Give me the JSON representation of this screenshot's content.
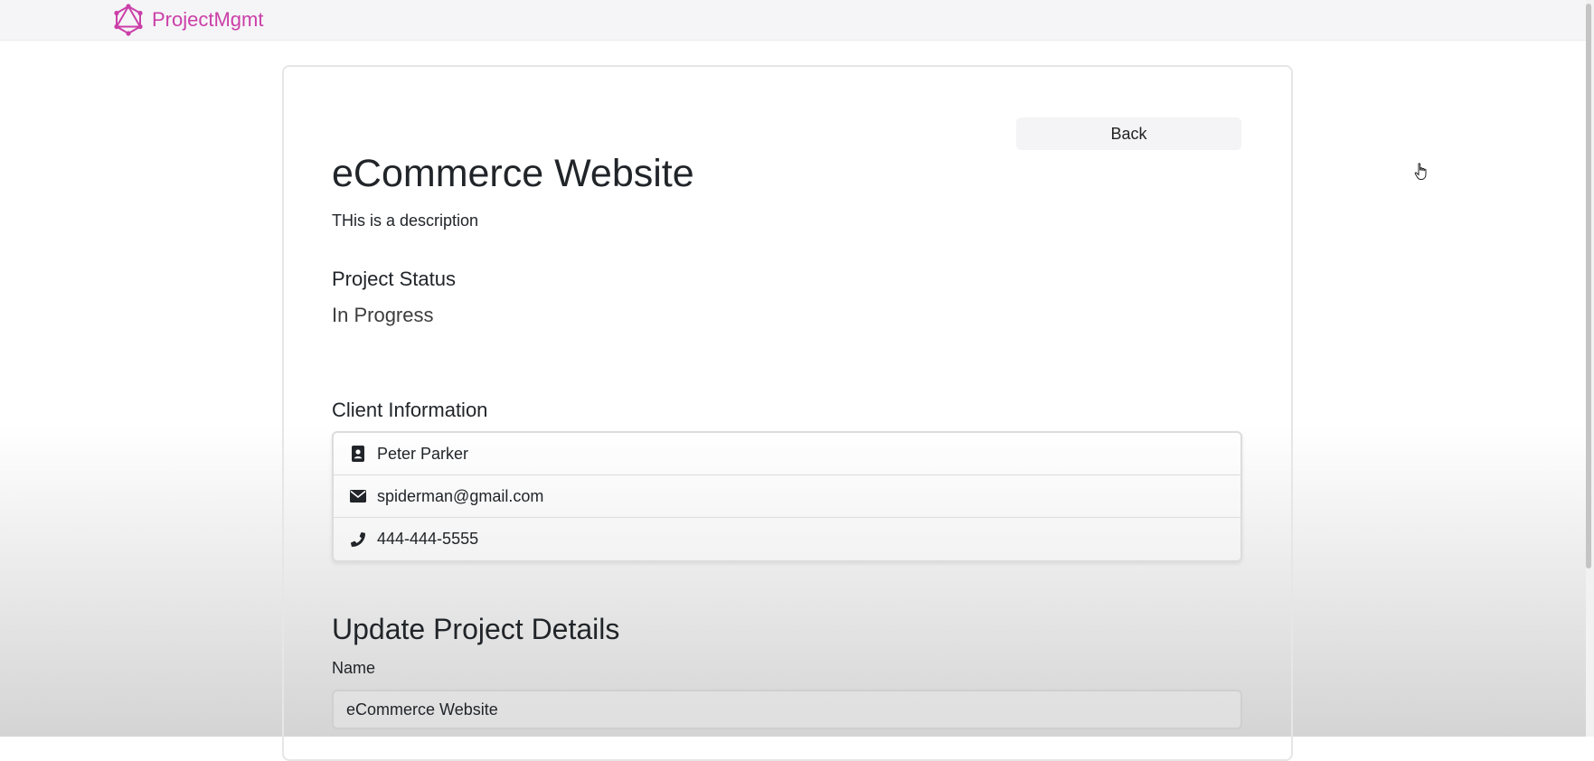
{
  "navbar": {
    "brand": "ProjectMgmt",
    "logo_icon": "graphql-logo-icon",
    "brand_color": "#cb3fa8"
  },
  "project": {
    "back_label": "Back",
    "title": "eCommerce Website",
    "description": "THis is a description",
    "status_heading": "Project Status",
    "status_value": "In Progress"
  },
  "client": {
    "heading": "Client Information",
    "items": [
      {
        "icon": "id-badge-icon",
        "text": "Peter Parker"
      },
      {
        "icon": "envelope-icon",
        "text": "spiderman@gmail.com"
      },
      {
        "icon": "phone-icon",
        "text": "444-444-5555"
      }
    ]
  },
  "update_form": {
    "heading": "Update Project Details",
    "name_label": "Name",
    "name_value": "eCommerce Website"
  }
}
